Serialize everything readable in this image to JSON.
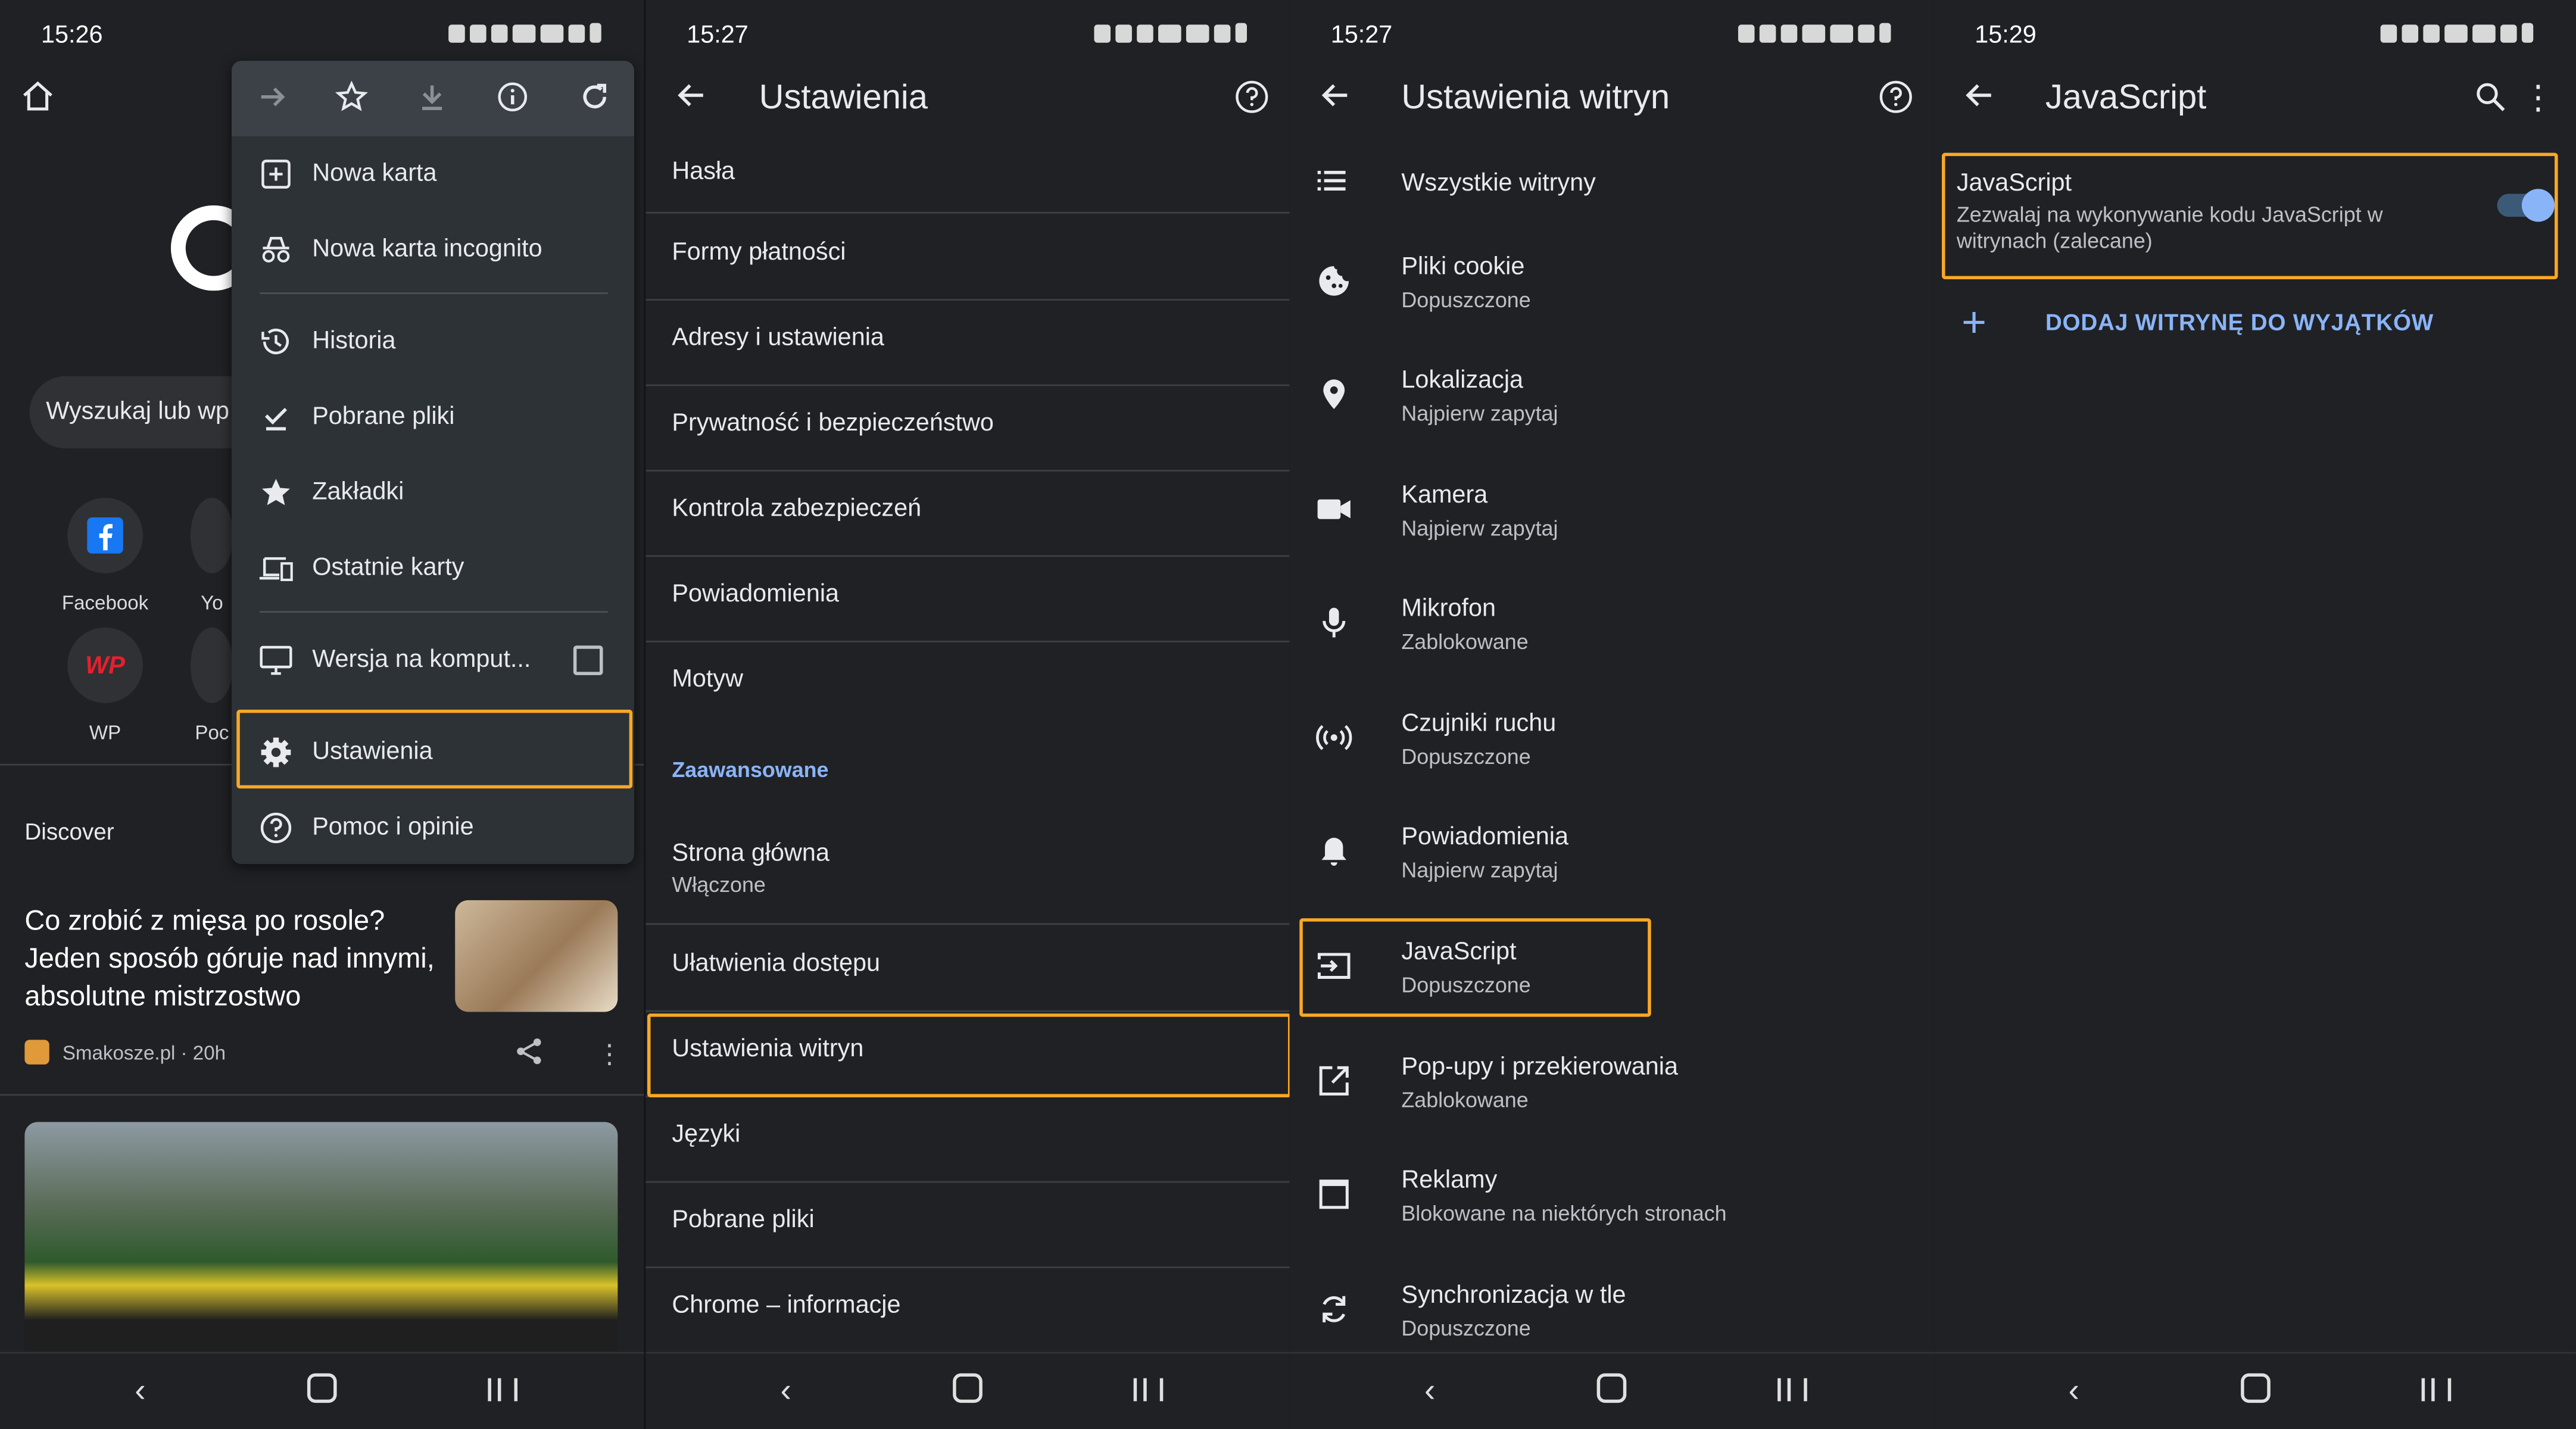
{
  "panel1": {
    "time": "15:26",
    "search_placeholder": "Wyszukaj lub wp",
    "tiles": [
      {
        "label": "Facebook"
      },
      {
        "label": "Yo"
      },
      {
        "label": "WP"
      },
      {
        "label": "Poc"
      }
    ],
    "menu": {
      "items": [
        {
          "label": "Nowa karta"
        },
        {
          "label": "Nowa karta incognito"
        },
        {
          "label": "Historia"
        },
        {
          "label": "Pobrane pliki"
        },
        {
          "label": "Zakładki"
        },
        {
          "label": "Ostatnie karty"
        },
        {
          "label": "Wersja na komput..."
        },
        {
          "label": "Ustawienia"
        },
        {
          "label": "Pomoc i opinie"
        }
      ]
    },
    "discover": "Discover",
    "article": {
      "title": "Co zrobić z mięsa po rosole? Jeden sposób góruje nad innymi, absolutne mistrzostwo",
      "source": "Smakosze.pl · 20h"
    }
  },
  "panel2": {
    "time": "15:27",
    "title": "Ustawienia",
    "rows": [
      {
        "title": "Hasła"
      },
      {
        "title": "Formy płatności"
      },
      {
        "title": "Adresy i ustawienia"
      },
      {
        "title": "Prywatność i bezpieczeństwo"
      },
      {
        "title": "Kontrola zabezpieczeń"
      },
      {
        "title": "Powiadomienia"
      },
      {
        "title": "Motyw"
      }
    ],
    "advanced_header": "Zaawansowane",
    "advanced_rows": [
      {
        "title": "Strona główna",
        "subtitle": "Włączone"
      },
      {
        "title": "Ułatwienia dostępu"
      },
      {
        "title": "Ustawienia witryn"
      },
      {
        "title": "Języki"
      },
      {
        "title": "Pobrane pliki"
      },
      {
        "title": "Chrome – informacje"
      }
    ]
  },
  "panel3": {
    "time": "15:27",
    "title": "Ustawienia witryn",
    "rows": [
      {
        "title": "Wszystkie witryny",
        "icon": "list-icon"
      },
      {
        "title": "Pliki cookie",
        "subtitle": "Dopuszczone",
        "icon": "cookie-icon"
      },
      {
        "title": "Lokalizacja",
        "subtitle": "Najpierw zapytaj",
        "icon": "location-pin-icon"
      },
      {
        "title": "Kamera",
        "subtitle": "Najpierw zapytaj",
        "icon": "camera-icon"
      },
      {
        "title": "Mikrofon",
        "subtitle": "Zablokowane",
        "icon": "microphone-icon"
      },
      {
        "title": "Czujniki ruchu",
        "subtitle": "Dopuszczone",
        "icon": "sensors-icon"
      },
      {
        "title": "Powiadomienia",
        "subtitle": "Najpierw zapytaj",
        "icon": "bell-icon"
      },
      {
        "title": "JavaScript",
        "subtitle": "Dopuszczone",
        "icon": "javascript-icon"
      },
      {
        "title": "Pop-upy i przekierowania",
        "subtitle": "Zablokowane",
        "icon": "open-external-icon"
      },
      {
        "title": "Reklamy",
        "subtitle": "Blokowane na niektórych stronach",
        "icon": "ads-window-icon"
      },
      {
        "title": "Synchronizacja w tle",
        "subtitle": "Dopuszczone",
        "icon": "sync-icon"
      }
    ]
  },
  "panel4": {
    "time": "15:29",
    "title": "JavaScript",
    "setting_title": "JavaScript",
    "setting_desc": "Zezwalaj na wykonywanie kodu JavaScript w witrynach (zalecane)",
    "toggle_on": true,
    "add_exception": "DODAJ WITRYNĘ DO WYJĄTKÓW"
  },
  "colors": {
    "background": "#202124",
    "accent": "#8ab4f8",
    "highlight": "#f9a825",
    "menu_bg": "#2d3237"
  }
}
